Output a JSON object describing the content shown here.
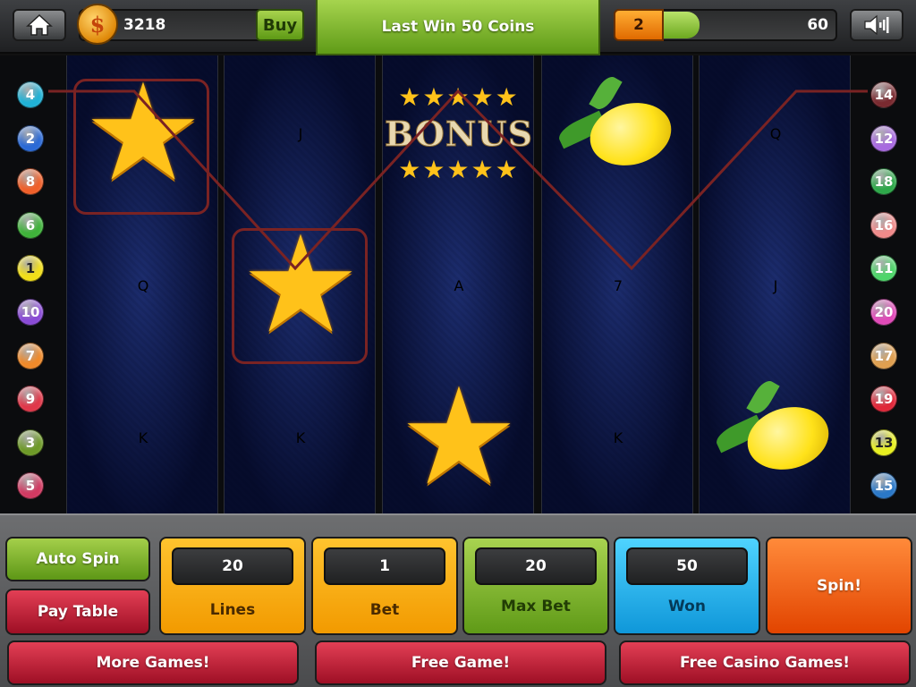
{
  "top_bar": {
    "home_icon": "home-icon",
    "coin_symbol": "$",
    "coins": "3218",
    "buy_label": "Buy",
    "last_win_label": "Last Win 50 Coins",
    "level": "2",
    "level_progress": 0.22,
    "xp": "60",
    "sound_icon": "speaker-icon"
  },
  "reels": [
    [
      "star",
      "Q",
      "K"
    ],
    [
      "J",
      "star",
      "K"
    ],
    [
      "bonus",
      "A",
      "star"
    ],
    [
      "lemon",
      "7",
      "K"
    ],
    [
      "Q",
      "J",
      "lemon"
    ]
  ],
  "bonus_text": "BONUS",
  "bonus_stars": "★★★★★",
  "left_lines": [
    {
      "n": "4",
      "color": "#20b2d6"
    },
    {
      "n": "2",
      "color": "#2b6ad6"
    },
    {
      "n": "8",
      "color": "#f0602a"
    },
    {
      "n": "6",
      "color": "#3fb33a"
    },
    {
      "n": "1",
      "color": "#f2df18"
    },
    {
      "n": "10",
      "color": "#8a4bd6"
    },
    {
      "n": "7",
      "color": "#f08a2a"
    },
    {
      "n": "9",
      "color": "#e0384a"
    },
    {
      "n": "3",
      "color": "#6e9a28"
    },
    {
      "n": "5",
      "color": "#d23a62"
    }
  ],
  "right_lines": [
    {
      "n": "14",
      "color": "#7a2a30"
    },
    {
      "n": "12",
      "color": "#a86ae0"
    },
    {
      "n": "18",
      "color": "#2ea84a"
    },
    {
      "n": "16",
      "color": "#f08a8a"
    },
    {
      "n": "11",
      "color": "#4ed66a"
    },
    {
      "n": "20",
      "color": "#e04ab8"
    },
    {
      "n": "17",
      "color": "#e0a050"
    },
    {
      "n": "19",
      "color": "#e0283a"
    },
    {
      "n": "13",
      "color": "#e8f020"
    },
    {
      "n": "15",
      "color": "#2a78c8"
    }
  ],
  "controls": {
    "auto_spin": "Auto Spin",
    "pay_table": "Pay Table",
    "lines_value": "20",
    "lines_label": "Lines",
    "bet_value": "1",
    "bet_label": "Bet",
    "max_bet_value": "20",
    "max_bet_label": "Max Bet",
    "won_value": "50",
    "won_label": "Won",
    "spin": "Spin!",
    "more_games": "More Games!",
    "free_game": "Free Game!",
    "free_casino": "Free Casino Games!"
  }
}
